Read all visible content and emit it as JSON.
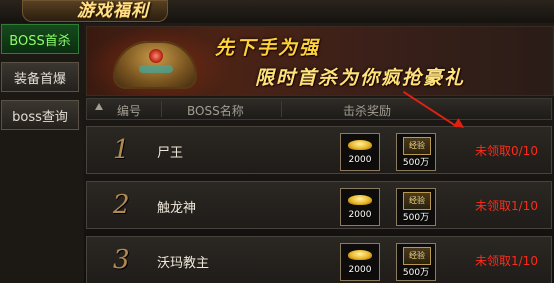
{
  "title": "游戏福利",
  "sidebar": {
    "items": [
      {
        "label": "BOSS首杀",
        "active": true
      },
      {
        "label": "装备首爆",
        "active": false
      },
      {
        "label": "boss查询",
        "active": false
      }
    ]
  },
  "banner": {
    "line1": "先下手为强",
    "line2": "限时首杀为你疯抢豪礼"
  },
  "table": {
    "headers": [
      "编号",
      "BOSS名称",
      "击杀奖励"
    ],
    "rows": [
      {
        "num": "1",
        "name": "尸王",
        "gold": "2000",
        "exp_label": "经验",
        "exp": "500万",
        "status": "未领取0/10"
      },
      {
        "num": "2",
        "name": "触龙神",
        "gold": "2000",
        "exp_label": "经验",
        "exp": "500万",
        "status": "未领取1/10"
      },
      {
        "num": "3",
        "name": "沃玛教主",
        "gold": "2000",
        "exp_label": "经验",
        "exp": "500万",
        "status": "未领取1/10"
      }
    ]
  },
  "colors": {
    "status": "#ff2a1a",
    "active_tab": "#8dff6a"
  }
}
